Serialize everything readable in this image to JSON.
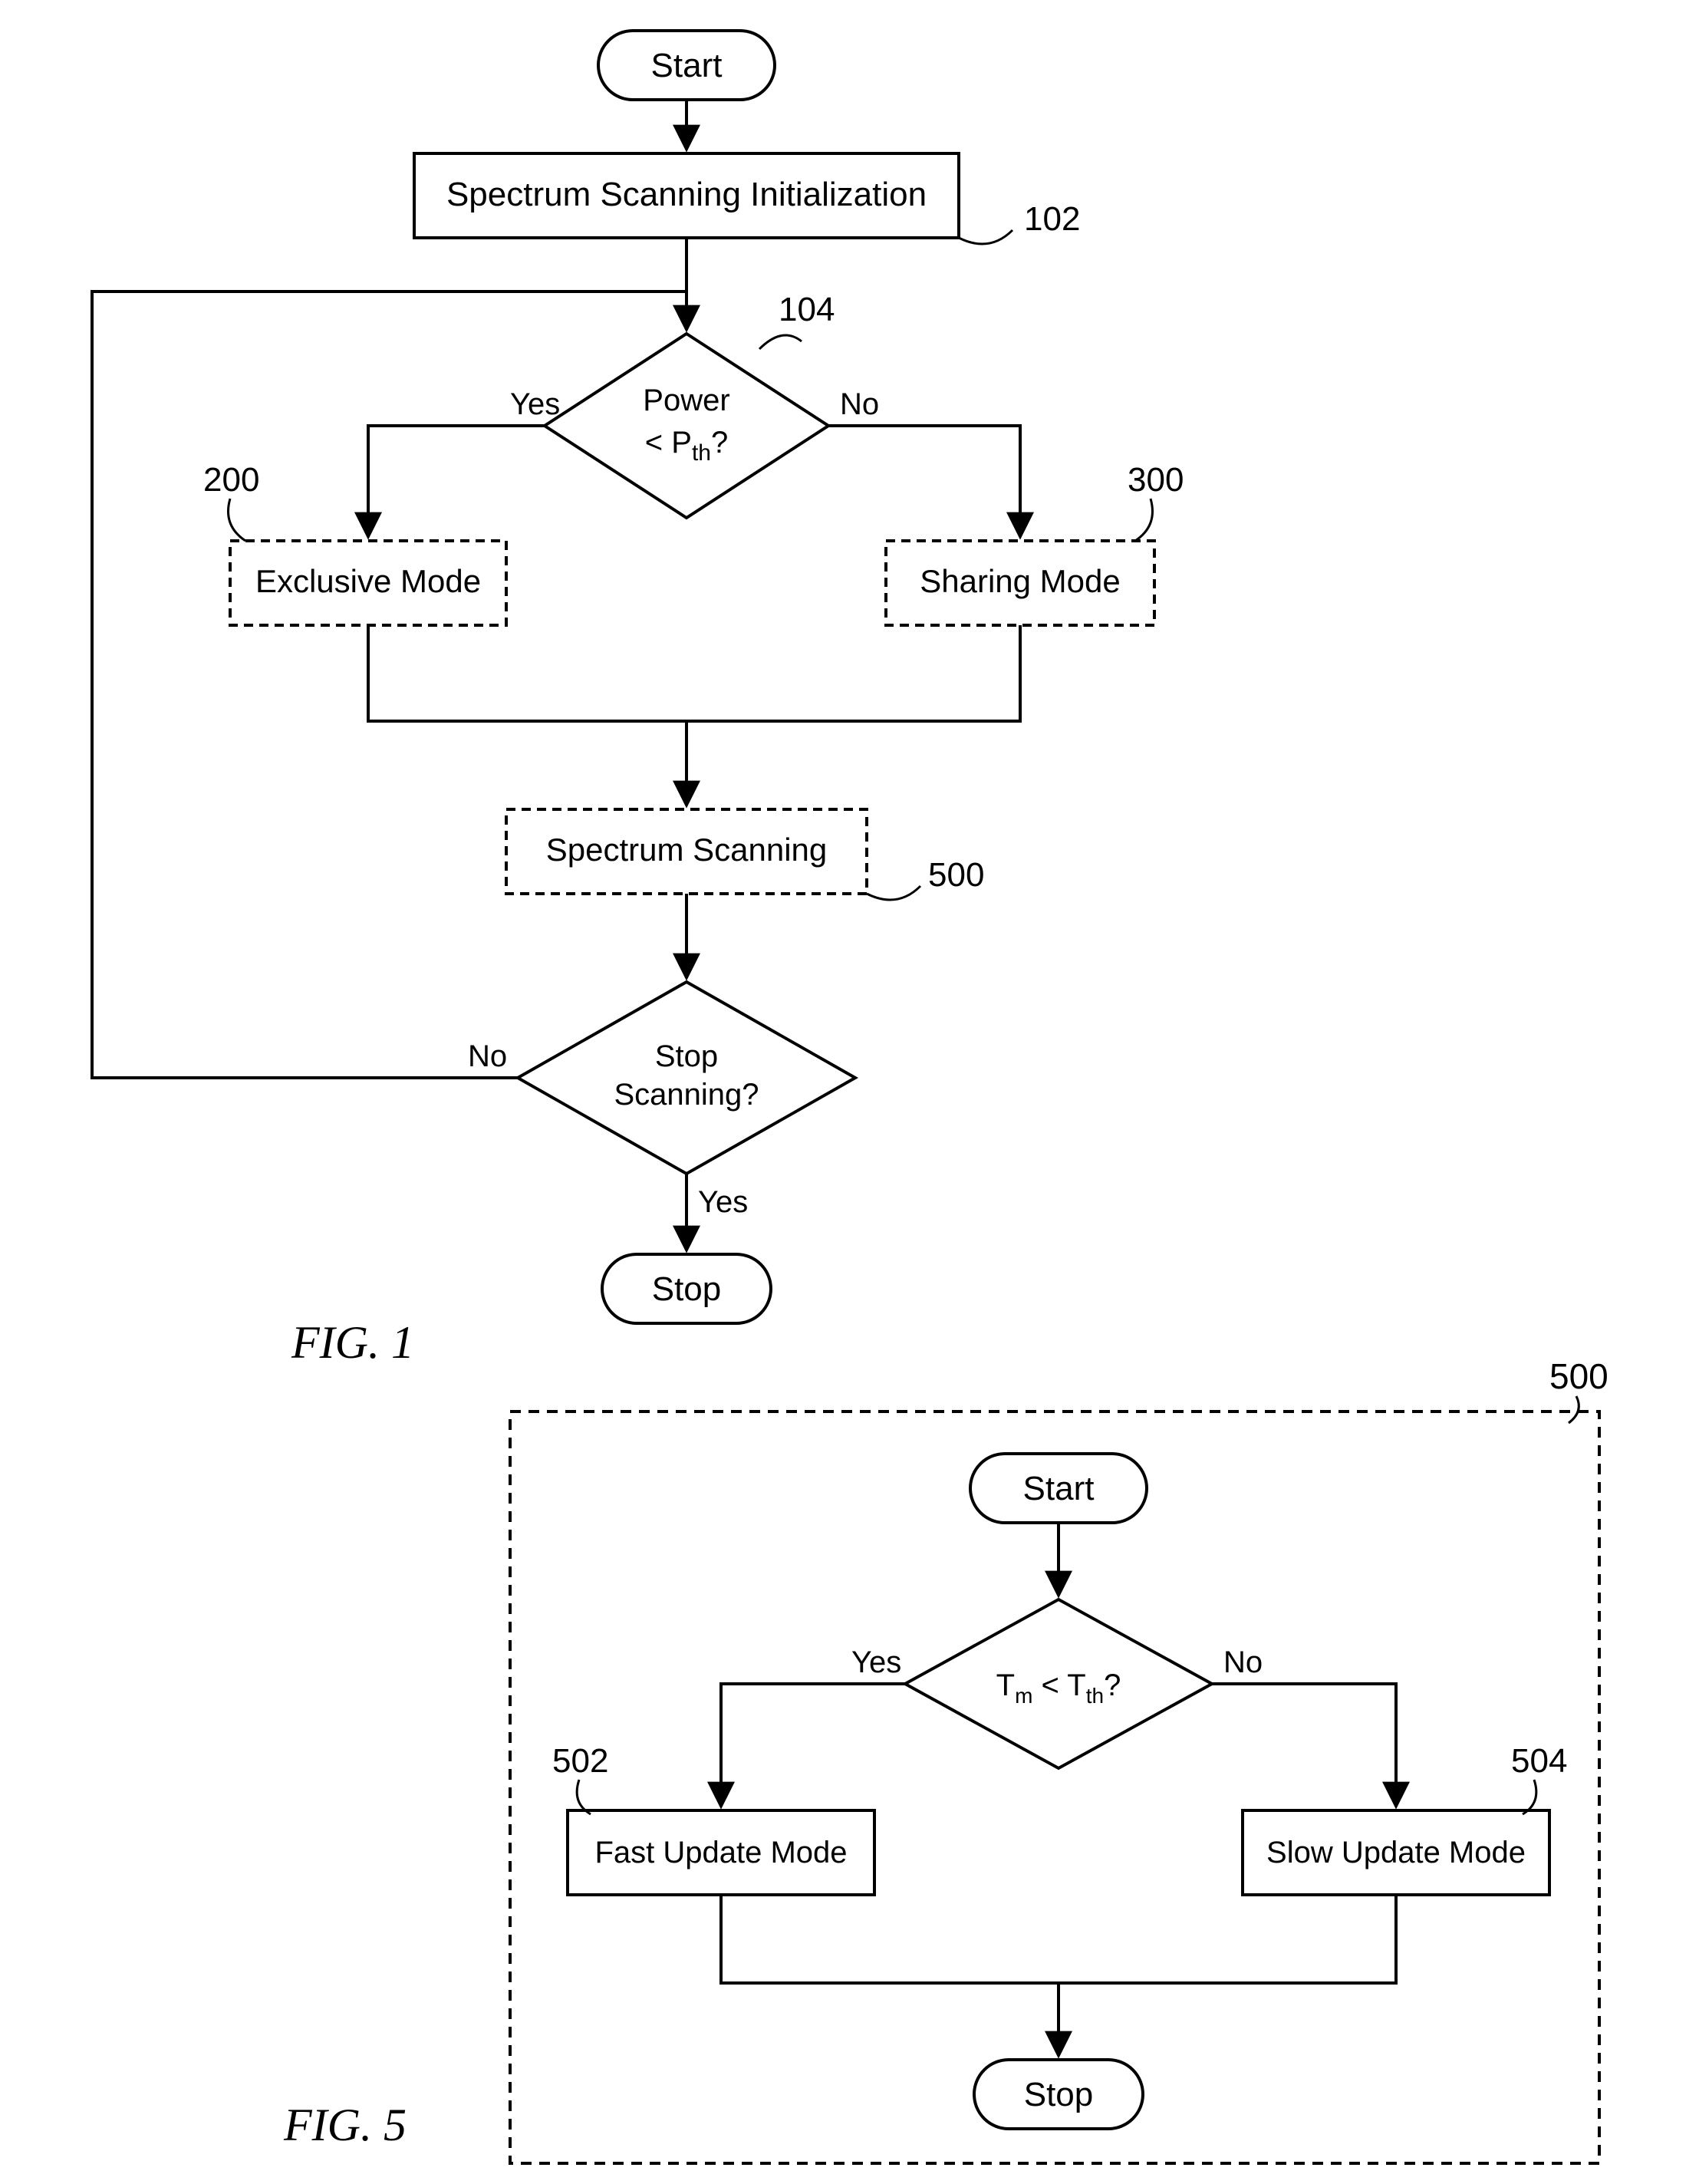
{
  "chart_data": [
    {
      "type": "flowchart",
      "figure_label": "FIG.  1",
      "nodes": [
        {
          "id": "start1",
          "shape": "terminal",
          "text": "Start"
        },
        {
          "id": "init",
          "shape": "process",
          "text": "Spectrum Scanning Initialization",
          "ref": "102"
        },
        {
          "id": "pow",
          "shape": "decision",
          "text_a": "Power",
          "text_b": "< P",
          "text_sub": "th",
          "text_c": "?",
          "ref": "104"
        },
        {
          "id": "excl",
          "shape": "process_dashed",
          "text": "Exclusive Mode",
          "ref": "200"
        },
        {
          "id": "share",
          "shape": "process_dashed",
          "text": "Sharing Mode",
          "ref": "300"
        },
        {
          "id": "scan",
          "shape": "process_dashed",
          "text": "Spectrum Scanning",
          "ref": "500"
        },
        {
          "id": "stopq",
          "shape": "decision",
          "text_a": "Stop",
          "text_b": "Scanning?"
        },
        {
          "id": "stop1",
          "shape": "terminal",
          "text": "Stop"
        }
      ],
      "edges": [
        {
          "from": "start1",
          "to": "init"
        },
        {
          "from": "init",
          "to": "pow"
        },
        {
          "from": "pow",
          "to": "excl",
          "label": "Yes"
        },
        {
          "from": "pow",
          "to": "share",
          "label": "No"
        },
        {
          "from": "excl",
          "to": "scan"
        },
        {
          "from": "share",
          "to": "scan"
        },
        {
          "from": "scan",
          "to": "stopq"
        },
        {
          "from": "stopq",
          "to": "stop1",
          "label": "Yes"
        },
        {
          "from": "stopq",
          "to": "pow",
          "label": "No",
          "loopback": true
        }
      ],
      "edge_labels": {
        "yes": "Yes",
        "no": "No"
      }
    },
    {
      "type": "flowchart",
      "figure_label": "FIG.  5",
      "container_ref": "500",
      "nodes": [
        {
          "id": "start5",
          "shape": "terminal",
          "text": "Start"
        },
        {
          "id": "tmq",
          "shape": "decision",
          "text_a": "T",
          "sub_a": "m",
          "mid": " < T",
          "sub_b": "th",
          "tail": "?"
        },
        {
          "id": "fast",
          "shape": "process",
          "text": "Fast Update Mode",
          "ref": "502"
        },
        {
          "id": "slow",
          "shape": "process",
          "text": "Slow Update Mode",
          "ref": "504"
        },
        {
          "id": "stop5",
          "shape": "terminal",
          "text": "Stop"
        }
      ],
      "edges": [
        {
          "from": "start5",
          "to": "tmq"
        },
        {
          "from": "tmq",
          "to": "fast",
          "label": "Yes"
        },
        {
          "from": "tmq",
          "to": "slow",
          "label": "No"
        },
        {
          "from": "fast",
          "to": "stop5"
        },
        {
          "from": "slow",
          "to": "stop5"
        }
      ],
      "edge_labels": {
        "yes": "Yes",
        "no": "No"
      }
    }
  ]
}
